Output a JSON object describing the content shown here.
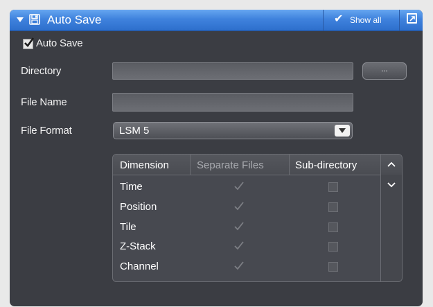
{
  "header": {
    "title": "Auto Save",
    "show_all_label": "Show all",
    "check_icon": "check-icon",
    "floppy_icon": "floppy-disk-icon",
    "undock_icon": "undock-icon",
    "accent_color": "#3f82dd"
  },
  "auto_save": {
    "label": "Auto Save",
    "checked": true
  },
  "directory": {
    "label": "Directory",
    "value": "",
    "browse_label": "..."
  },
  "file_name": {
    "label": "File Name",
    "value": ""
  },
  "file_format": {
    "label": "File Format",
    "selected": "LSM 5"
  },
  "table": {
    "columns": [
      "Dimension",
      "Separate Files",
      "Sub-directory"
    ],
    "rows": [
      {
        "dimension": "Time",
        "separate_files": true,
        "sub_directory": false
      },
      {
        "dimension": "Position",
        "separate_files": true,
        "sub_directory": false
      },
      {
        "dimension": "Tile",
        "separate_files": true,
        "sub_directory": false
      },
      {
        "dimension": "Z-Stack",
        "separate_files": true,
        "sub_directory": false
      },
      {
        "dimension": "Channel",
        "separate_files": true,
        "sub_directory": false
      }
    ]
  }
}
